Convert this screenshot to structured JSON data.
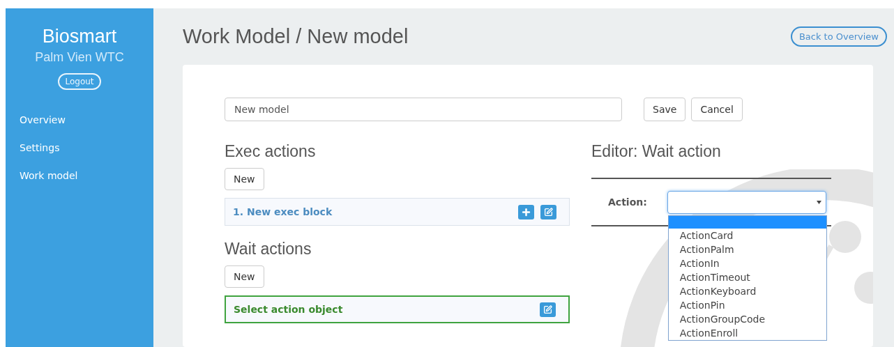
{
  "sidebar": {
    "brand": "Biosmart",
    "site": "Palm Vien WTC",
    "logout": "Logout",
    "items": [
      {
        "label": "Overview"
      },
      {
        "label": "Settings"
      },
      {
        "label": "Work model"
      }
    ]
  },
  "header": {
    "title": "Work Model / New model",
    "back_button": "Back to Overview"
  },
  "model_form": {
    "name_value": "New model",
    "buttons": [
      "Save",
      "Cancel"
    ]
  },
  "exec_actions": {
    "title": "Exec actions",
    "new_button": "New",
    "blocks": [
      {
        "label": "1. New exec block",
        "kind": "exec"
      }
    ]
  },
  "wait_actions": {
    "title": "Wait actions",
    "new_button": "New",
    "blocks": [
      {
        "label": "Select action object",
        "kind": "wait"
      }
    ]
  },
  "editor": {
    "title": "Editor: Wait action",
    "action_label": "Action:",
    "dropdown_open": true,
    "blank_option_highlighted": true,
    "options": [
      {
        "label": "ActionCard",
        "selected": false
      },
      {
        "label": "ActionPalm",
        "selected": false
      },
      {
        "label": "ActionIn",
        "selected": false
      },
      {
        "label": "ActionTimeout",
        "selected": false
      },
      {
        "label": "ActionKeyboard",
        "selected": false
      },
      {
        "label": "ActionPin",
        "selected": false
      },
      {
        "label": "ActionGroupCode",
        "selected": false
      },
      {
        "label": "ActionEnroll",
        "selected": false
      }
    ]
  }
}
